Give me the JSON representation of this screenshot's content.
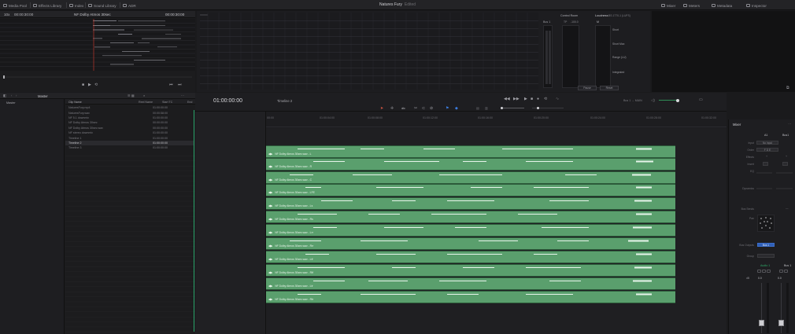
{
  "topbar": {
    "items": [
      "Media Pool",
      "Effects Library",
      "Index",
      "Sound Library",
      "ADR"
    ],
    "project_title": "Natures Fury",
    "project_status": "Edited",
    "right_items": [
      "Mixer",
      "Meters",
      "Metadata",
      "Inspector"
    ]
  },
  "viewer": {
    "zoom": "10x",
    "timecode_left": "00:00:30:00",
    "clip_name": "NF Dolby Atmos 30sec",
    "timecode_right": "00:00:30:00"
  },
  "meters": {
    "bus_label": "Bus 1",
    "control_room_label": "Control Room",
    "control_room_tp": "TP",
    "control_room_tp_value": "-100.0",
    "loudness_label": "Loudness",
    "loudness_standard": "BS.1770-1 (LUFS)",
    "m_label": "M",
    "loudness_rows": [
      "Short",
      "Short Max",
      "Range (LU)",
      "Integrated"
    ],
    "pause_label": "Pause",
    "reset_label": "Reset"
  },
  "media_pool": {
    "bin_title": "Master",
    "bin_tree_item": "Master",
    "columns": [
      "Clip Name",
      "Reel Name",
      "Start TC",
      "End"
    ],
    "clips": [
      {
        "name": "NaturesFury.mp4",
        "tc": "01:00:00:00"
      },
      {
        "name": "NaturesFury.wav",
        "tc": "00:00:58:00"
      },
      {
        "name": "NF 5.1 downmix",
        "tc": "01:00:00:00"
      },
      {
        "name": "NF Dolby Atmos 30sec",
        "tc": "00:00:00:00"
      },
      {
        "name": "NF Dolby Atmos 30sec.wav",
        "tc": "00:00:00:00"
      },
      {
        "name": "NF stereo downmix",
        "tc": "01:00:00:00"
      },
      {
        "name": "Timeline 1",
        "tc": "01:00:00:00"
      },
      {
        "name": "Timeline 2",
        "tc": "01:00:00:00"
      },
      {
        "name": "Timeline 3",
        "tc": "01:00:00:00"
      }
    ]
  },
  "timeline": {
    "timecode": "01:00:00:00",
    "name": "Timeline 2",
    "header_timecodes": [
      "00:00:00:00",
      "00:00:00:00",
      "00:00:00:00"
    ],
    "video_track": {
      "id": "V1",
      "name": "Video 1"
    },
    "audio_track": {
      "id": "A1",
      "name": "Audio 1",
      "format": "7.1.4",
      "volume": "0.0",
      "clip_count": "1 Clip"
    },
    "ruler": [
      "00:00",
      "01:00:04:00",
      "01:00:08:00",
      "01:00:12:00",
      "01:00:16:00",
      "01:00:20:00",
      "01:00:24:00",
      "01:00:28:00",
      "01:00:32:00"
    ],
    "clip_labels": [
      "NF Dolby Atmos 30sec.wav - L",
      "NF Dolby Atmos 30sec.wav - R",
      "NF Dolby Atmos 30sec.wav - C",
      "NF Dolby Atmos 30sec.wav - LFE",
      "NF Dolby Atmos 30sec.wav - Ls",
      "NF Dolby Atmos 30sec.wav - Rs",
      "NF Dolby Atmos 30sec.wav - Lrr",
      "NF Dolby Atmos 30sec.wav - Rrr",
      "NF Dolby Atmos 30sec.wav - Ltf",
      "NF Dolby Atmos 30sec.wav - Rtf",
      "NF Dolby Atmos 30sec.wav - Ltr",
      "NF Dolby Atmos 30sec.wav - Rtr"
    ],
    "bus_routing": "Bus 1 → MAIN",
    "clip_color": "#5a9f6d"
  },
  "mixer": {
    "title": "Mixer",
    "channels": [
      "A1",
      "Bus1"
    ],
    "rows": [
      "Input",
      "Order",
      "Effects",
      "Insert",
      "EQ",
      "Dynamics",
      "Bus Sends",
      "Pan",
      "Bus Outputs",
      "Group"
    ],
    "input_value": "No Input",
    "order_value": "F D E",
    "bus_output_value": "Bus 1",
    "channel_names": [
      "Audio 1",
      "Bus 1"
    ],
    "fader_values": [
      "0.0",
      "0.0"
    ]
  }
}
